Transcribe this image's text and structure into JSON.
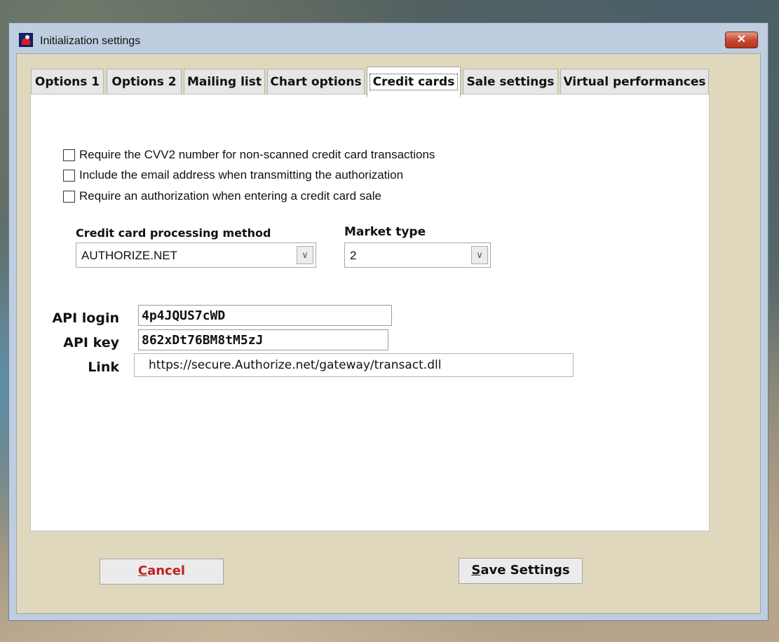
{
  "window": {
    "title": "Initialization settings",
    "close_glyph": "✕",
    "icon": "app-logo-icon"
  },
  "tabs": [
    {
      "label": "Options 1",
      "active": false
    },
    {
      "label": "Options 2",
      "active": false
    },
    {
      "label": "Mailing list",
      "active": false
    },
    {
      "label": "Chart options",
      "active": false
    },
    {
      "label": "Credit cards",
      "active": true
    },
    {
      "label": "Sale settings",
      "active": false
    },
    {
      "label": "Virtual performances",
      "active": false
    }
  ],
  "credit_cards": {
    "checkboxes": [
      {
        "label": "Require the CVV2 number for non-scanned credit card transactions",
        "checked": false
      },
      {
        "label": "Include the email address when transmitting the authorization",
        "checked": false
      },
      {
        "label": "Require an authorization when entering a credit card sale",
        "checked": false
      }
    ],
    "processing_method": {
      "label": "Credit card processing method",
      "value": "AUTHORIZE.NET"
    },
    "market_type": {
      "label": "Market type",
      "value": "2"
    },
    "api_login": {
      "label": "API login",
      "value": "4p4JQUS7cWD"
    },
    "api_key": {
      "label": "API key",
      "value": "862xDt76BM8tM5zJ"
    },
    "link": {
      "label": "Link",
      "value": "https://secure.Authorize.net/gateway/transact.dll"
    }
  },
  "buttons": {
    "cancel_first": "C",
    "cancel_rest": "ancel",
    "save_first": "S",
    "save_rest": "ave Settings"
  },
  "colors": {
    "dialog_bg": "#e0d8bc",
    "cancel_text": "#c02020",
    "close_button": "#c74a32"
  }
}
